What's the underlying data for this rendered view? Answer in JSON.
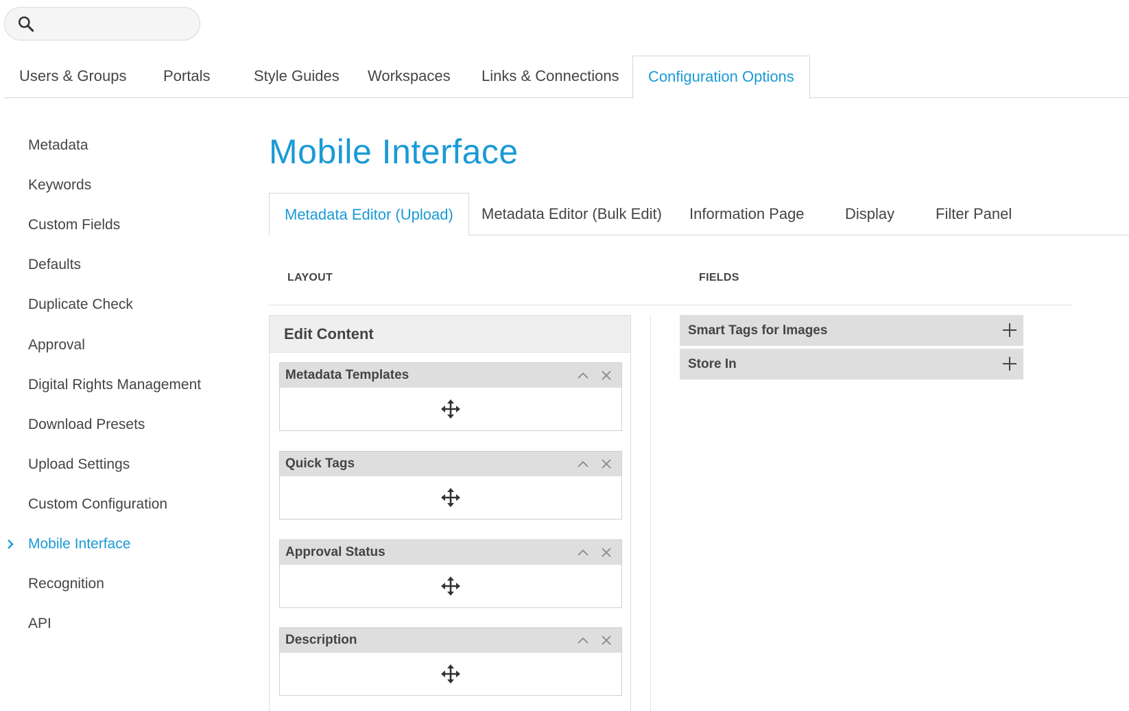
{
  "search": {
    "placeholder": ""
  },
  "top_nav": {
    "tabs": [
      {
        "label": "Users & Groups",
        "active": false
      },
      {
        "label": "Portals",
        "active": false
      },
      {
        "label": "Style Guides",
        "active": false
      },
      {
        "label": "Workspaces",
        "active": false
      },
      {
        "label": "Links & Connections",
        "active": false
      },
      {
        "label": "Configuration Options",
        "active": true
      }
    ]
  },
  "sidebar": {
    "items": [
      {
        "label": "Metadata"
      },
      {
        "label": "Keywords"
      },
      {
        "label": "Custom Fields"
      },
      {
        "label": "Defaults"
      },
      {
        "label": "Duplicate Check"
      },
      {
        "label": "Approval"
      },
      {
        "label": "Digital Rights Management"
      },
      {
        "label": "Download Presets"
      },
      {
        "label": "Upload Settings"
      },
      {
        "label": "Custom Configuration"
      },
      {
        "label": "Mobile Interface",
        "active": true
      },
      {
        "label": "Recognition"
      },
      {
        "label": "API"
      }
    ]
  },
  "main": {
    "title": "Mobile Interface",
    "sub_tabs": [
      {
        "label": "Metadata Editor (Upload)",
        "active": true
      },
      {
        "label": "Metadata Editor (Bulk Edit)"
      },
      {
        "label": "Information Page"
      },
      {
        "label": "Display"
      },
      {
        "label": "Filter Panel"
      }
    ],
    "layout_header": "LAYOUT",
    "fields_header": "FIELDS",
    "layout_panel": {
      "title": "Edit Content",
      "cards": [
        {
          "label": "Metadata Templates"
        },
        {
          "label": "Quick Tags"
        },
        {
          "label": "Approval Status"
        },
        {
          "label": "Description"
        }
      ]
    },
    "fields": [
      {
        "label": "Smart Tags for Images"
      },
      {
        "label": "Store In"
      }
    ]
  },
  "colors": {
    "accent": "#1a9ad6",
    "text": "#444444",
    "card_header_bg": "#dedede",
    "panel_header_bg": "#efefef"
  }
}
